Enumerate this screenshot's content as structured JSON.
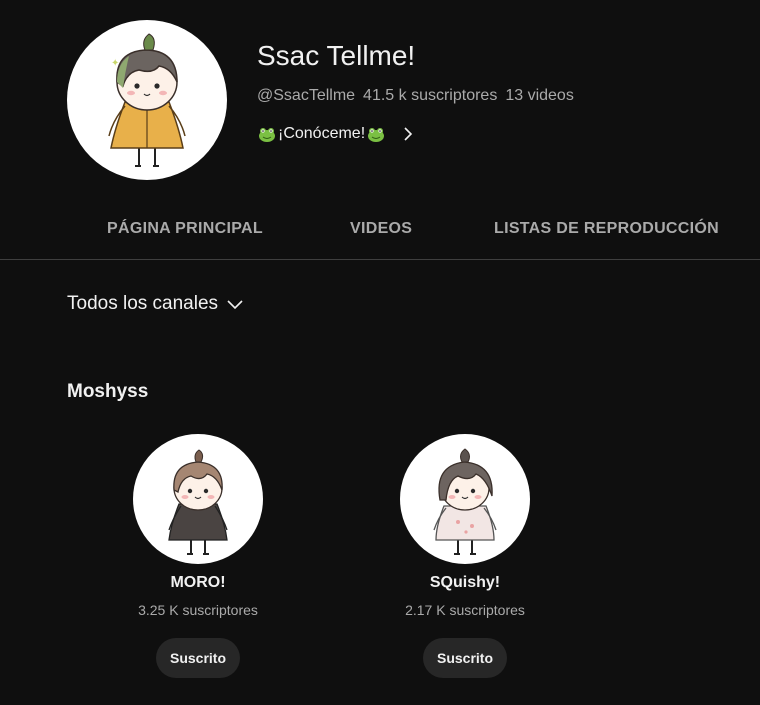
{
  "channel": {
    "name": "Ssac Tellme!",
    "handle": "@SsacTellme",
    "subscribers": "41.5 k suscriptores",
    "videos": "13 videos",
    "about_link": "¡Conóceme!"
  },
  "tabs": [
    {
      "label": "PÁGINA PRINCIPAL"
    },
    {
      "label": "VIDEOS"
    },
    {
      "label": "LISTAS DE REPRODUCCIÓN"
    }
  ],
  "filter": {
    "label": "Todos los canales"
  },
  "section": {
    "title": "Moshyss"
  },
  "channels": [
    {
      "name": "MORO!",
      "subscribers": "3.25 K suscriptores",
      "button": "Suscrito"
    },
    {
      "name": "SQuishy!",
      "subscribers": "2.17 K suscriptores",
      "button": "Suscrito"
    }
  ],
  "colors": {
    "background": "#0f0f0f",
    "text_primary": "#f1f1f1",
    "text_secondary": "#aaaaaa",
    "button_bg": "#272727",
    "divider": "#3f3f3f"
  },
  "icons": {
    "about_prefix": "frog-emoji-icon",
    "about_suffix": "frog-emoji-icon",
    "about_arrow": "chevron-right-icon",
    "filter_arrow": "chevron-down-icon"
  }
}
